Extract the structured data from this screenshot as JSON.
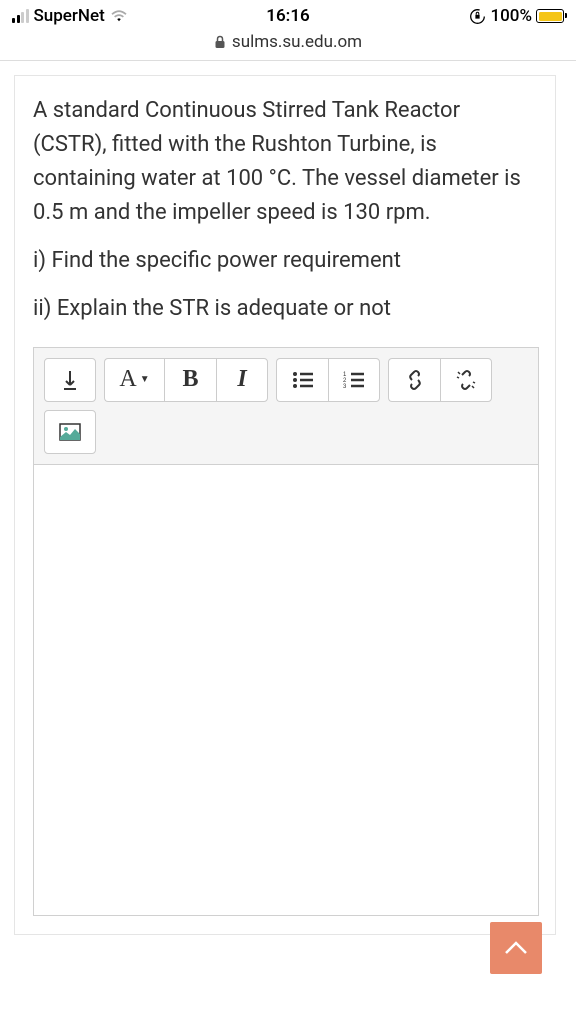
{
  "statusBar": {
    "carrier": "SuperNet",
    "time": "16:16",
    "battery": "100%"
  },
  "addressBar": {
    "url": "sulms.su.edu.om"
  },
  "question": {
    "intro": "A standard Continuous Stirred Tank Reactor (CSTR), fitted with the Rushton Turbine, is containing water at 100 °C. The vessel diameter is 0.5 m and the impeller speed is 130 rpm.",
    "part1": "i) Find the specific power requirement",
    "part2": "ii) Explain the STR is adequate or not"
  },
  "toolbar": {
    "fontLabel": "A",
    "boldLabel": "B",
    "italicLabel": "I"
  }
}
